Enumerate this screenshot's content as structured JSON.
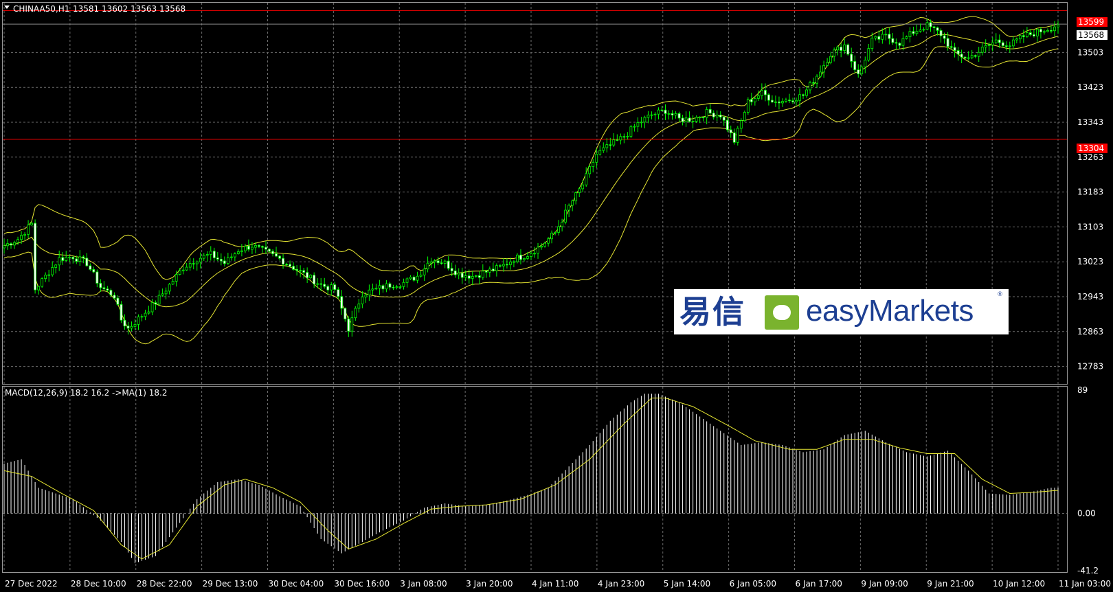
{
  "header": {
    "symbol": "CHINAA50,H1",
    "ohlc": "13581 13602 13563 13568"
  },
  "macd_header": "MACD(12,26,9) 18.2 16.2  ->MA(1) 18.2",
  "price_tags": {
    "upper_red": "13599",
    "current": "13568",
    "lower_red": "13304"
  },
  "logo": {
    "chinese": "易信",
    "english": "easyMarkets",
    "mark": "®"
  },
  "colors": {
    "background": "#000000",
    "grid": "#6b6b6b",
    "candle": "#00ff00",
    "band": "#e6e632",
    "hline": "#ff0000",
    "macd_hist": "#ffffff",
    "macd_signal": "#e6e632"
  },
  "chart_data": [
    {
      "type": "candlestick",
      "title": "CHINAA50,H1",
      "ylim": [
        12743,
        13617
      ],
      "y_ticks": [
        "13503",
        "13423",
        "13343",
        "13263",
        "13183",
        "13103",
        "13023",
        "12943",
        "12863",
        "12783"
      ],
      "x_ticks": [
        "27 Dec 2022",
        "28 Dec 10:00",
        "28 Dec 22:00",
        "29 Dec 13:00",
        "30 Dec 04:00",
        "30 Dec 16:00",
        "3 Jan 08:00",
        "3 Jan 20:00",
        "4 Jan 11:00",
        "4 Jan 23:00",
        "5 Jan 14:00",
        "6 Jan 05:00",
        "6 Jan 17:00",
        "9 Jan 09:00",
        "9 Jan 21:00",
        "10 Jan 12:00",
        "11 Jan 03:00"
      ],
      "horizontal_lines": [
        13599,
        13304
      ],
      "last_price": 13568,
      "grid": true,
      "close_path": [
        [
          0,
          13060
        ],
        [
          4,
          13075
        ],
        [
          8,
          13110
        ],
        [
          9,
          12960
        ],
        [
          12,
          12990
        ],
        [
          16,
          13030
        ],
        [
          20,
          13035
        ],
        [
          24,
          13020
        ],
        [
          28,
          12965
        ],
        [
          32,
          12945
        ],
        [
          34,
          12890
        ],
        [
          36,
          12870
        ],
        [
          40,
          12900
        ],
        [
          44,
          12930
        ],
        [
          48,
          12970
        ],
        [
          52,
          13010
        ],
        [
          56,
          13030
        ],
        [
          60,
          13040
        ],
        [
          64,
          13020
        ],
        [
          68,
          13050
        ],
        [
          72,
          13060
        ],
        [
          76,
          13045
        ],
        [
          80,
          13030
        ],
        [
          84,
          13010
        ],
        [
          88,
          12990
        ],
        [
          92,
          12970
        ],
        [
          96,
          12960
        ],
        [
          100,
          12870
        ],
        [
          104,
          12950
        ],
        [
          108,
          12960
        ],
        [
          112,
          12970
        ],
        [
          116,
          12975
        ],
        [
          120,
          12990
        ],
        [
          124,
          13030
        ],
        [
          128,
          13020
        ],
        [
          132,
          12995
        ],
        [
          136,
          12990
        ],
        [
          140,
          13000
        ],
        [
          144,
          13010
        ],
        [
          148,
          13030
        ],
        [
          152,
          13040
        ],
        [
          156,
          13060
        ],
        [
          160,
          13090
        ],
        [
          164,
          13150
        ],
        [
          168,
          13200
        ],
        [
          172,
          13270
        ],
        [
          176,
          13290
        ],
        [
          180,
          13310
        ],
        [
          184,
          13340
        ],
        [
          188,
          13360
        ],
        [
          192,
          13370
        ],
        [
          196,
          13350
        ],
        [
          200,
          13350
        ],
        [
          204,
          13365
        ],
        [
          208,
          13360
        ],
        [
          212,
          13300
        ],
        [
          216,
          13390
        ],
        [
          220,
          13410
        ],
        [
          224,
          13390
        ],
        [
          228,
          13395
        ],
        [
          232,
          13405
        ],
        [
          236,
          13450
        ],
        [
          240,
          13500
        ],
        [
          244,
          13520
        ],
        [
          248,
          13450
        ],
        [
          252,
          13530
        ],
        [
          256,
          13540
        ],
        [
          260,
          13525
        ],
        [
          264,
          13550
        ],
        [
          268,
          13565
        ],
        [
          272,
          13545
        ],
        [
          276,
          13500
        ],
        [
          280,
          13490
        ],
        [
          284,
          13510
        ],
        [
          288,
          13530
        ],
        [
          292,
          13520
        ],
        [
          296,
          13540
        ],
        [
          300,
          13550
        ],
        [
          304,
          13560
        ],
        [
          306,
          13568
        ]
      ]
    },
    {
      "type": "macd",
      "title": "MACD(12,26,9) 18.2 16.2  ->MA(1) 18.2",
      "ylim": [
        -41.2,
        89
      ],
      "y_ticks": [
        "89",
        "0.00",
        "-41.2"
      ],
      "hist_path": [
        [
          0,
          35
        ],
        [
          5,
          38
        ],
        [
          10,
          18
        ],
        [
          20,
          10
        ],
        [
          28,
          -5
        ],
        [
          34,
          -20
        ],
        [
          38,
          -35
        ],
        [
          44,
          -30
        ],
        [
          50,
          -10
        ],
        [
          56,
          10
        ],
        [
          62,
          22
        ],
        [
          68,
          24
        ],
        [
          74,
          20
        ],
        [
          80,
          12
        ],
        [
          86,
          5
        ],
        [
          92,
          -18
        ],
        [
          98,
          -28
        ],
        [
          104,
          -20
        ],
        [
          110,
          -12
        ],
        [
          116,
          -5
        ],
        [
          122,
          4
        ],
        [
          128,
          7
        ],
        [
          134,
          5
        ],
        [
          140,
          6
        ],
        [
          146,
          9
        ],
        [
          152,
          13
        ],
        [
          158,
          18
        ],
        [
          164,
          33
        ],
        [
          170,
          48
        ],
        [
          176,
          65
        ],
        [
          182,
          78
        ],
        [
          186,
          84
        ],
        [
          190,
          84
        ],
        [
          196,
          78
        ],
        [
          202,
          68
        ],
        [
          208,
          58
        ],
        [
          214,
          48
        ],
        [
          220,
          50
        ],
        [
          226,
          48
        ],
        [
          232,
          43
        ],
        [
          238,
          45
        ],
        [
          244,
          55
        ],
        [
          250,
          58
        ],
        [
          256,
          50
        ],
        [
          262,
          43
        ],
        [
          268,
          40
        ],
        [
          274,
          44
        ],
        [
          280,
          30
        ],
        [
          286,
          14
        ],
        [
          292,
          13
        ],
        [
          298,
          15
        ],
        [
          304,
          18
        ],
        [
          306,
          18.2
        ]
      ],
      "signal_path": [
        [
          0,
          30
        ],
        [
          8,
          26
        ],
        [
          16,
          15
        ],
        [
          26,
          2
        ],
        [
          34,
          -22
        ],
        [
          40,
          -32
        ],
        [
          48,
          -22
        ],
        [
          56,
          5
        ],
        [
          64,
          20
        ],
        [
          70,
          24
        ],
        [
          78,
          18
        ],
        [
          86,
          8
        ],
        [
          94,
          -12
        ],
        [
          100,
          -25
        ],
        [
          108,
          -18
        ],
        [
          116,
          -7
        ],
        [
          124,
          3
        ],
        [
          132,
          5
        ],
        [
          140,
          6
        ],
        [
          150,
          10
        ],
        [
          160,
          20
        ],
        [
          170,
          38
        ],
        [
          180,
          63
        ],
        [
          188,
          81
        ],
        [
          192,
          81
        ],
        [
          200,
          75
        ],
        [
          210,
          62
        ],
        [
          218,
          51
        ],
        [
          228,
          45
        ],
        [
          236,
          45
        ],
        [
          244,
          52
        ],
        [
          252,
          52
        ],
        [
          260,
          46
        ],
        [
          268,
          42
        ],
        [
          276,
          42
        ],
        [
          284,
          24
        ],
        [
          292,
          14
        ],
        [
          300,
          15
        ],
        [
          306,
          16.2
        ]
      ]
    }
  ]
}
